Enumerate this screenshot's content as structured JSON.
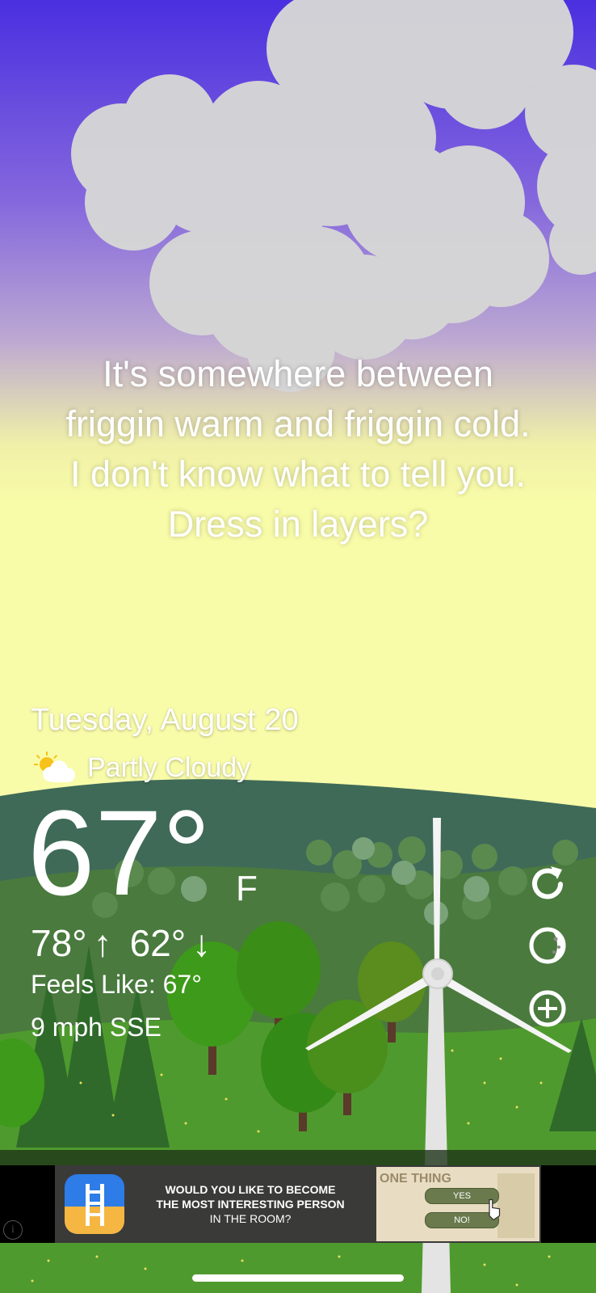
{
  "message": {
    "line1": "It's somewhere between",
    "line2": "friggin warm and friggin cold.",
    "line3": "I don't know what to tell you.",
    "line4": "Dress in layers?"
  },
  "weather": {
    "date": "Tuesday, August 20",
    "condition": "Partly Cloudy",
    "condition_icon": "partly-cloudy-icon",
    "temperature": "67°",
    "unit": "F",
    "high": "78°",
    "high_arrow": "↑",
    "low": "62°",
    "low_arrow": "↓",
    "feels_like": "Feels Like: 67°",
    "wind": "9 mph SSE"
  },
  "controls": {
    "refresh_icon": "refresh-icon",
    "moon_icon": "moon-phase-icon",
    "add_icon": "add-icon"
  },
  "ad": {
    "line1": "WOULD YOU LIKE TO BECOME",
    "line2": "THE MOST INTERESTING PERSON",
    "line3": "IN THE ROOM?",
    "image_title": "ONE THING",
    "yes": "YES",
    "no": "NO!",
    "info": "i"
  },
  "colors": {
    "sky_top": "#4a2fe0",
    "sky_mid": "#a48bd8",
    "sky_bottom": "#f6f8a8",
    "hill": "#3f6a58",
    "grass": "#4f9a2e"
  }
}
